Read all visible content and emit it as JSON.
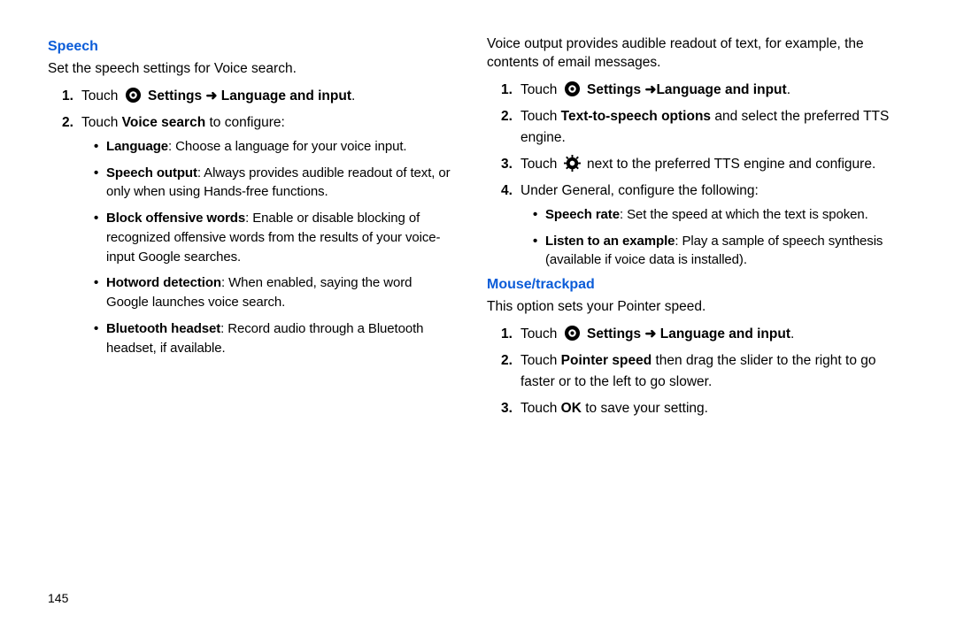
{
  "page_number": "145",
  "arrow_glyph": "➜",
  "left": {
    "heading": "Speech",
    "intro": "Set the speech settings for Voice search.",
    "step1": {
      "num": "1.",
      "prefix": "Touch ",
      "bold1": "Settings ",
      "bold2": " Language and input",
      "suffix": "."
    },
    "step2": {
      "num": "2.",
      "prefix": "Touch ",
      "bold": "Voice search",
      "suffix": " to configure:"
    },
    "bullets": [
      {
        "bold": "Language",
        "text": ": Choose a language for your voice input."
      },
      {
        "bold": "Speech output",
        "text": ": Always provides audible readout of text, or only when using Hands-free functions."
      },
      {
        "bold": "Block offensive words",
        "text": ": Enable or disable blocking of recognized offensive words from the results of your voice-input Google searches."
      },
      {
        "bold": "Hotword detection",
        "text": ": When enabled, saying the word Google launches voice search."
      },
      {
        "bold": "Bluetooth headset",
        "text": ": Record audio through a Bluetooth headset, if available."
      }
    ]
  },
  "right": {
    "intro": "Voice output provides audible readout of text, for example, the contents of email messages.",
    "step1": {
      "num": "1.",
      "prefix": "Touch ",
      "bold1": "Settings ",
      "bold2": "Language and input",
      "suffix": "."
    },
    "step2": {
      "num": "2.",
      "prefix": "Touch ",
      "bold": "Text-to-speech options",
      "suffix": " and select the preferred TTS engine."
    },
    "step3": {
      "num": "3.",
      "prefix": "Touch ",
      "suffix": " next to the preferred TTS engine and configure."
    },
    "step4": {
      "num": "4.",
      "text": "Under General, configure the following:"
    },
    "bullets": [
      {
        "bold": "Speech rate",
        "text": ": Set the speed at which the text is spoken."
      },
      {
        "bold": "Listen to an example",
        "text": ": Play a sample of speech synthesis (available if voice data is installed)."
      }
    ],
    "heading2": "Mouse/trackpad",
    "intro2": "This option sets your Pointer speed.",
    "m_step1": {
      "num": "1.",
      "prefix": "Touch ",
      "bold1": "Settings ",
      "bold2": " Language and input",
      "suffix": "."
    },
    "m_step2": {
      "num": "2.",
      "prefix": "Touch ",
      "bold": "Pointer speed",
      "suffix": " then drag the slider to the right to go faster or to the left to go slower."
    },
    "m_step3": {
      "num": "3.",
      "prefix": "Touch ",
      "bold": "OK",
      "suffix": " to save your setting."
    }
  }
}
